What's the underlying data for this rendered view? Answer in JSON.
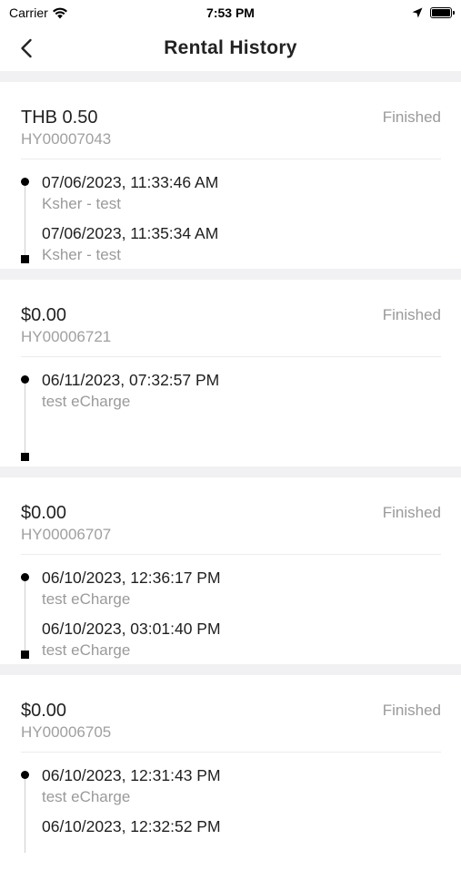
{
  "status_bar": {
    "carrier": "Carrier",
    "time": "7:53 PM",
    "battery_level": 1.0
  },
  "nav": {
    "title": "Rental History",
    "back_icon": "chevron-left-icon"
  },
  "rentals": [
    {
      "amount": "THB 0.50",
      "status": "Finished",
      "order_id": "HY00007043",
      "start_time": "07/06/2023, 11:33:46 AM",
      "start_place": "Ksher - test",
      "end_time": "07/06/2023, 11:35:34 AM",
      "end_place": "Ksher - test"
    },
    {
      "amount": "$0.00",
      "status": "Finished",
      "order_id": "HY00006721",
      "start_time": "06/11/2023, 07:32:57 PM",
      "start_place": "test eCharge",
      "end_time": "",
      "end_place": ""
    },
    {
      "amount": "$0.00",
      "status": "Finished",
      "order_id": "HY00006707",
      "start_time": "06/10/2023, 12:36:17 PM",
      "start_place": "test eCharge",
      "end_time": "06/10/2023, 03:01:40 PM",
      "end_place": "test eCharge"
    },
    {
      "amount": "$0.00",
      "status": "Finished",
      "order_id": "HY00006705",
      "start_time": "06/10/2023, 12:31:43 PM",
      "start_place": "test eCharge",
      "end_time": "06/10/2023, 12:32:52 PM",
      "end_place": ""
    }
  ]
}
